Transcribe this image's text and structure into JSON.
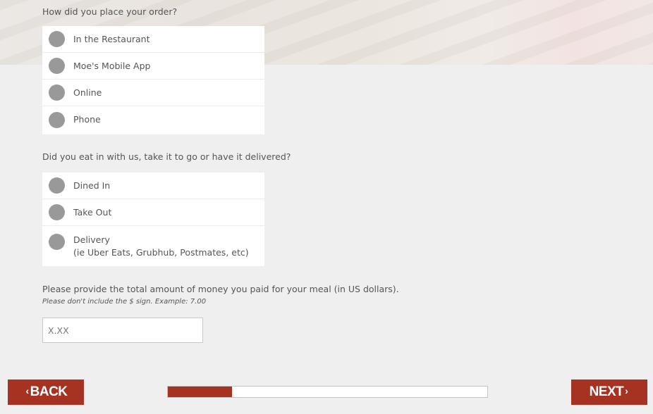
{
  "q1": {
    "question": "How did you place your order?",
    "options": [
      "In the Restaurant",
      "Moe's Mobile App",
      "Online",
      "Phone"
    ]
  },
  "q2": {
    "question": "Did you eat in with us, take it to go or have it delivered?",
    "options": [
      {
        "label": "Dined In",
        "sub": ""
      },
      {
        "label": "Take Out",
        "sub": ""
      },
      {
        "label": "Delivery",
        "sub": "(ie Uber Eats, Grubhub, Postmates, etc)"
      }
    ]
  },
  "q3": {
    "question": "Please provide the total amount of money you paid for your meal (in US dollars).",
    "hint": "Please don't include the $ sign. Example: 7.00",
    "placeholder": "X.XX",
    "value": ""
  },
  "nav": {
    "back_label": "BACK",
    "next_label": "NEXT",
    "back_icon": "chevron-left-icon",
    "next_icon": "chevron-right-icon",
    "progress_percent": 20,
    "accent_color": "#a63322"
  }
}
